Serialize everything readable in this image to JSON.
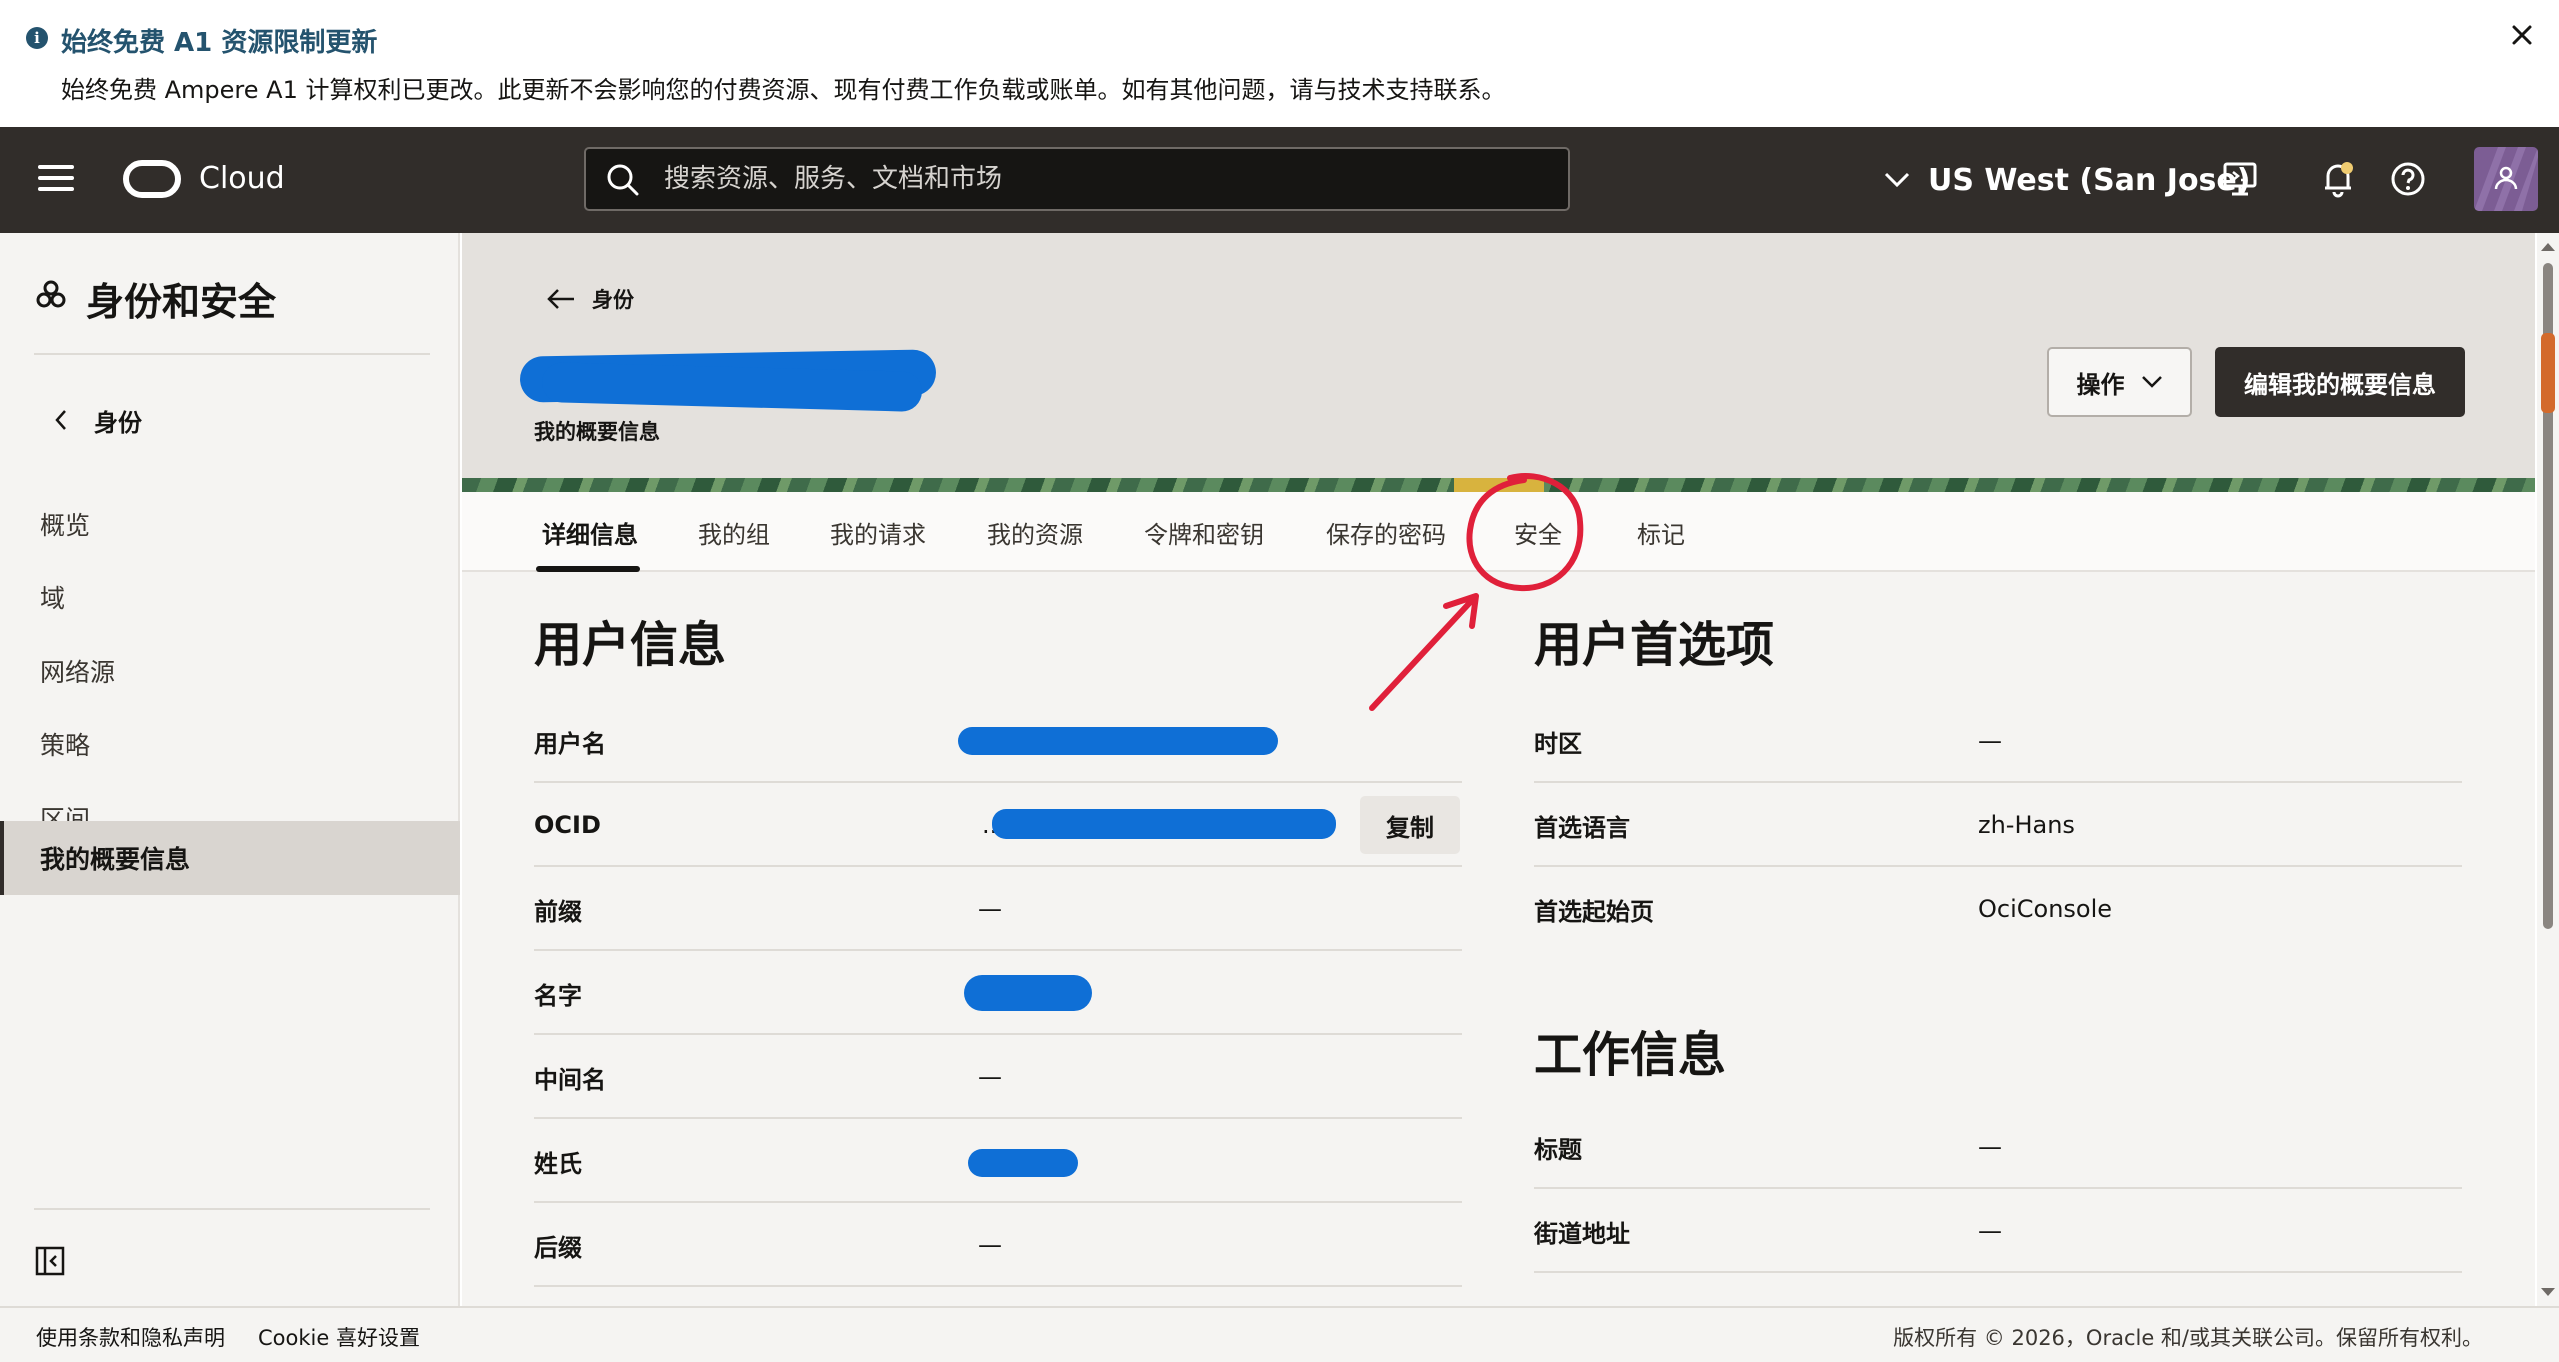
{
  "banner": {
    "title": "始终免费 A1 资源限制更新",
    "text": "始终免费 Ampere A1 计算权利已更改。此更新不会影响您的付费资源、现有付费工作负载或账单。如有其他问题，请与技术支持联系。"
  },
  "header": {
    "brand": "Cloud",
    "search_placeholder": "搜索资源、服务、文档和市场",
    "region": "US West (San Jose)"
  },
  "sidebar": {
    "title": "身份和安全",
    "back_label": "身份",
    "items": [
      {
        "label": "概览"
      },
      {
        "label": "域"
      },
      {
        "label": "网络源"
      },
      {
        "label": "策略"
      },
      {
        "label": "区间"
      },
      {
        "label": "我的概要信息"
      }
    ]
  },
  "hero": {
    "breadcrumb": "身份",
    "subtitle": "我的概要信息",
    "actions_label": "操作",
    "edit_label": "编辑我的概要信息"
  },
  "tabs": [
    {
      "label": "详细信息"
    },
    {
      "label": "我的组"
    },
    {
      "label": "我的请求"
    },
    {
      "label": "我的资源"
    },
    {
      "label": "令牌和密钥"
    },
    {
      "label": "保存的密码"
    },
    {
      "label": "安全"
    },
    {
      "label": "标记"
    }
  ],
  "user_info": {
    "title": "用户信息",
    "copy_label": "复制",
    "rows": [
      {
        "label": "用户名",
        "value": ""
      },
      {
        "label": "OCID",
        "value": ".."
      },
      {
        "label": "前缀",
        "value": "—"
      },
      {
        "label": "名字",
        "value": ""
      },
      {
        "label": "中间名",
        "value": "—"
      },
      {
        "label": "姓氏",
        "value": ""
      },
      {
        "label": "后缀",
        "value": "—"
      }
    ]
  },
  "preferences": {
    "title": "用户首选项",
    "rows": [
      {
        "label": "时区",
        "value": "—"
      },
      {
        "label": "首选语言",
        "value": "zh-Hans"
      },
      {
        "label": "首选起始页",
        "value": "OciConsole"
      }
    ]
  },
  "work_info": {
    "title": "工作信息",
    "rows": [
      {
        "label": "标题",
        "value": "—"
      },
      {
        "label": "街道地址",
        "value": "—"
      }
    ]
  },
  "footer": {
    "terms": "使用条款和隐私声明",
    "cookies": "Cookie 喜好设置",
    "copyright": "版权所有 © 2026，Oracle 和/或其关联公司。保留所有权利。"
  },
  "colors": {
    "header_bg": "#312d2a",
    "banner_accent": "#24536e",
    "redaction": "#0f6fd6",
    "annotation": "#e0203a"
  },
  "icons": [
    "info-icon",
    "close-icon",
    "menu-icon",
    "search-icon",
    "chevron-down-icon",
    "developer-tools-icon",
    "bell-icon",
    "help-icon",
    "user-icon",
    "identity-icon",
    "chevron-left-icon",
    "arrow-left-icon",
    "collapse-sidebar-icon"
  ]
}
